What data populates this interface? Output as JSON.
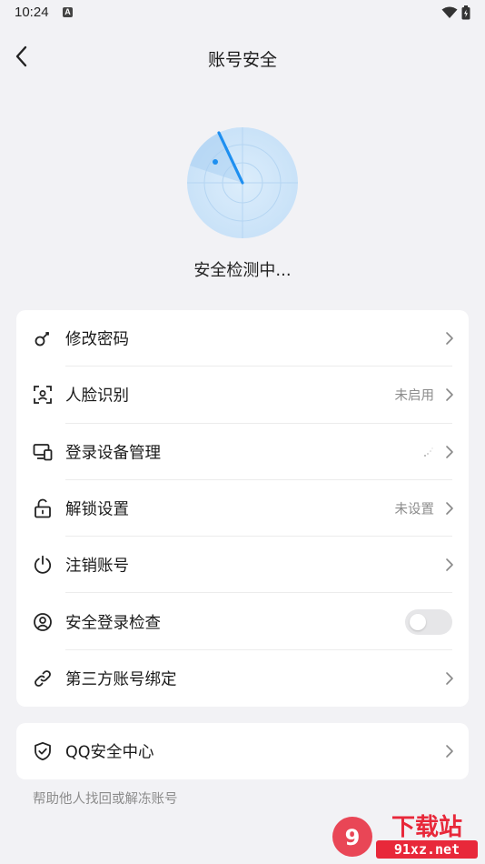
{
  "status_bar": {
    "time": "10:24",
    "notif_icon": "A"
  },
  "header": {
    "title": "账号安全",
    "back_icon": "chevron-left-icon"
  },
  "scan": {
    "status_text": "安全检测中..."
  },
  "settings": [
    {
      "icon": "key-icon",
      "label": "修改密码",
      "value": ""
    },
    {
      "icon": "face-scan-icon",
      "label": "人脸识别",
      "value": "未启用"
    },
    {
      "icon": "devices-icon",
      "label": "登录设备管理",
      "value": ""
    },
    {
      "icon": "unlock-icon",
      "label": "解锁设置",
      "value": "未设置"
    },
    {
      "icon": "power-icon",
      "label": "注销账号",
      "value": ""
    },
    {
      "icon": "user-circle-icon",
      "label": "安全登录检查",
      "toggle_on": false
    },
    {
      "icon": "link-icon",
      "label": "第三方账号绑定",
      "value": ""
    }
  ],
  "qq_center": {
    "icon": "shield-check-icon",
    "label": "QQ安全中心",
    "note": "帮助他人找回或解冻账号"
  },
  "watermark": {
    "brand": "下载站",
    "domain": "91xz.net"
  },
  "colors": {
    "accent": "#1e8ff0",
    "background": "#f2f2f5",
    "watermark": "#e8283a"
  }
}
